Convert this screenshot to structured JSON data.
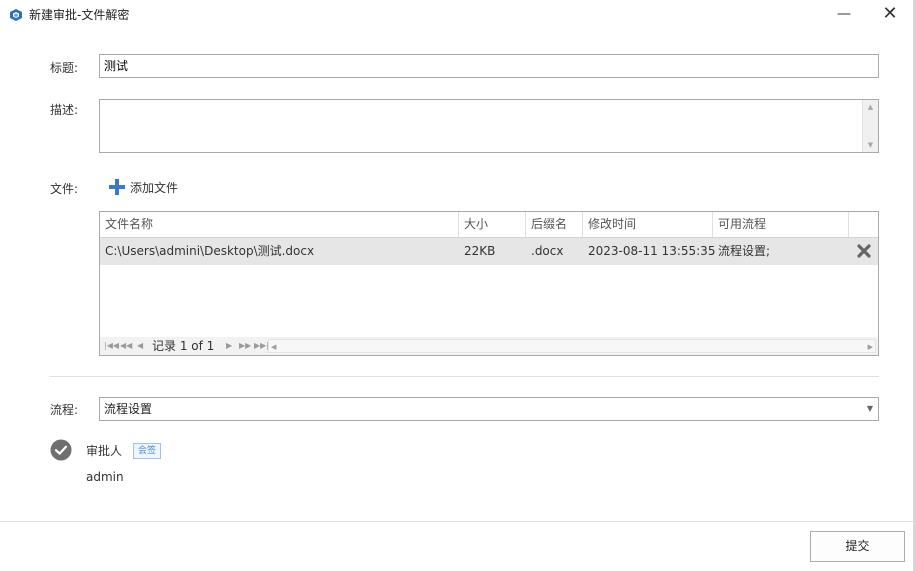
{
  "window": {
    "title": "新建审批-文件解密",
    "minimize_glyph": "—",
    "close_glyph": "✕"
  },
  "form": {
    "title_label": "标题:",
    "title_value": "测试",
    "description_label": "描述:",
    "description_value": "",
    "files_label": "文件:",
    "add_file_label": "添加文件",
    "flow_label": "流程:",
    "flow_value": "流程设置"
  },
  "file_table": {
    "columns": [
      "文件名称",
      "大小",
      "后缀名",
      "修改时间",
      "可用流程"
    ],
    "rows": [
      {
        "name": "C:\\Users\\admini\\Desktop\\测试.docx",
        "size": "22KB",
        "ext": ".docx",
        "modified": "2023-08-11 13:55:35",
        "flow": "流程设置;"
      }
    ],
    "pager_text": "记录 1 of 1"
  },
  "approval": {
    "approver_label": "审批人",
    "badge": "会签",
    "approver_name": "admin"
  },
  "footer": {
    "submit_label": "提交"
  },
  "colors": {
    "accent": "#3a7bc8",
    "selected_row": "#e6e6e6",
    "badge_border": "#9cc3ea"
  },
  "icons": [
    "app-icon",
    "plus-icon",
    "delete-x-icon",
    "check-circle-icon",
    "dropdown-arrow-icon"
  ]
}
